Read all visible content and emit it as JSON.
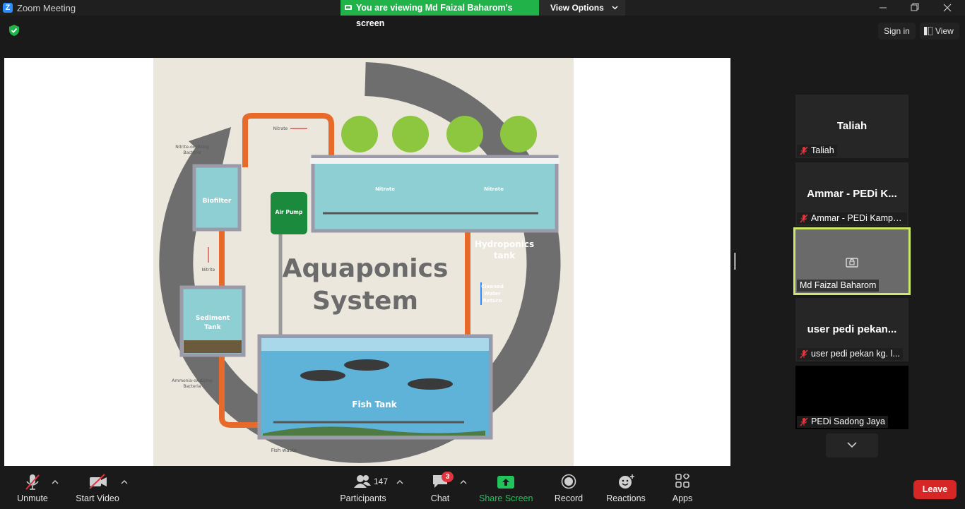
{
  "window": {
    "title": "Zoom Meeting",
    "logo_letter": "Z",
    "viewing_banner": "You are viewing Md Faizal Baharom's screen",
    "view_options": "View Options"
  },
  "top_right": {
    "sign_in": "Sign in",
    "view": "View"
  },
  "slide": {
    "title_line1": "Aquaponics",
    "title_line2": "System",
    "labels": {
      "nitrate_top": "Nitrate",
      "nitrite_oxidizing_1": "Nitrite-oxidizing",
      "nitrite_oxidizing_2": "Bacteria",
      "biofilter": "Biofilter",
      "air_pump": "Air Pump",
      "nitrate_left": "Nitrate",
      "nitrate_right": "Nitrate",
      "hydroponics_1": "Hydroponics",
      "hydroponics_2": "tank",
      "nitrite": "Nitrite",
      "cleaned_1": "Cleaned",
      "cleaned_2": "Water",
      "cleaned_3": "Return",
      "sediment_1": "Sediment",
      "sediment_2": "Tank",
      "ammonia_1": "Ammonia-oxidizing",
      "ammonia_2": "Bacteria",
      "fish_tank": "Fish Tank",
      "fish_waste": "Fish waste"
    }
  },
  "participants_panel": {
    "tiles": [
      {
        "big_name": "Taliah",
        "label": "Taliah",
        "muted": true
      },
      {
        "big_name": "Ammar - PEDi K...",
        "label": "Ammar - PEDi Kampu...",
        "muted": true
      },
      {
        "big_name": "",
        "label": "Md Faizal Baharom",
        "muted": false,
        "active": true
      },
      {
        "big_name": "user pedi pekan...",
        "label": "user pedi pekan kg. l...",
        "muted": true
      },
      {
        "big_name": "",
        "label": "PEDi Sadong Jaya",
        "muted": true
      }
    ]
  },
  "toolbar": {
    "unmute": "Unmute",
    "start_video": "Start Video",
    "participants": "Participants",
    "participants_count": "147",
    "chat": "Chat",
    "chat_badge": "3",
    "share_screen": "Share Screen",
    "record": "Record",
    "reactions": "Reactions",
    "apps": "Apps",
    "leave": "Leave"
  },
  "colors": {
    "share_green": "#21b34a",
    "active_border": "#cde86a",
    "leave_red": "#d72626",
    "mute_red": "#e0343f"
  }
}
